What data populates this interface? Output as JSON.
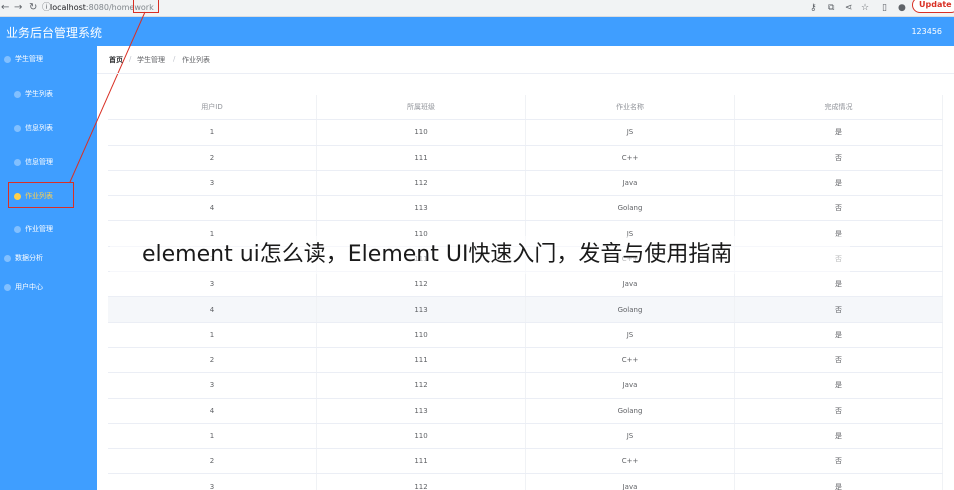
{
  "browser": {
    "url_host": "localhost",
    "url_rest": ":8080/homework",
    "update_label": "Update"
  },
  "header": {
    "title": "业务后台管理系统",
    "user": "123456"
  },
  "sidebar": {
    "items": [
      {
        "label": "学生管理"
      },
      {
        "label": "学生列表"
      },
      {
        "label": "信息列表"
      },
      {
        "label": "信息管理"
      },
      {
        "label": "作业列表"
      },
      {
        "label": "作业管理"
      },
      {
        "label": "数据分析"
      },
      {
        "label": "用户中心"
      }
    ],
    "active_index": 4
  },
  "breadcrumb": {
    "items": [
      "首页",
      "学生管理",
      "作业列表"
    ],
    "separator": "/"
  },
  "table": {
    "columns": [
      "用户ID",
      "所属班级",
      "作业名称",
      "完成情况"
    ],
    "rows": [
      [
        "1",
        "110",
        "JS",
        "是"
      ],
      [
        "2",
        "111",
        "C++",
        "否"
      ],
      [
        "3",
        "112",
        "Java",
        "是"
      ],
      [
        "4",
        "113",
        "Golang",
        "否"
      ],
      [
        "1",
        "110",
        "JS",
        "是"
      ],
      [
        "2",
        "111",
        "C++",
        "否"
      ],
      [
        "3",
        "112",
        "Java",
        "是"
      ],
      [
        "4",
        "113",
        "Golang",
        "否"
      ],
      [
        "1",
        "110",
        "JS",
        "是"
      ],
      [
        "2",
        "111",
        "C++",
        "否"
      ],
      [
        "3",
        "112",
        "Java",
        "是"
      ],
      [
        "4",
        "113",
        "Golang",
        "否"
      ],
      [
        "1",
        "110",
        "JS",
        "是"
      ],
      [
        "2",
        "111",
        "C++",
        "否"
      ],
      [
        "3",
        "112",
        "Java",
        "是"
      ]
    ],
    "highlight_row_index": 7
  },
  "overlay": {
    "caption": "element ui怎么读，Element UI快速入门，发音与使用指南"
  },
  "colors": {
    "accent": "#3f9eff",
    "active_menu": "#ffd04b",
    "annotation": "#d93025"
  }
}
